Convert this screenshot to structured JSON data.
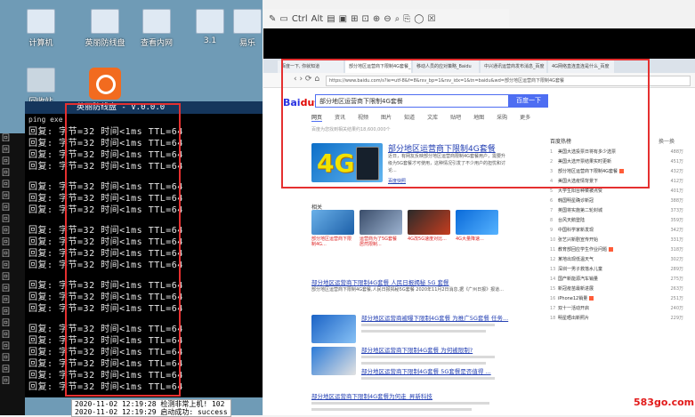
{
  "desktop": {
    "icons": [
      {
        "label": "计算机",
        "name": "computer"
      },
      {
        "label": "英丽防线盘",
        "name": "folder-1"
      },
      {
        "label": "查看内网",
        "name": "folder-2"
      },
      {
        "label": "3.1",
        "name": "folder-3"
      },
      {
        "label": "易乐",
        "name": "folder-4"
      },
      {
        "label": "回收站",
        "name": "recycle-bin"
      }
    ]
  },
  "console": {
    "title": "英丽防线盘 - V.0.0.0",
    "subtitle": "ping exe",
    "line_text": "回复: 字节=32 时间<1ms TTL=64",
    "status_lines": [
      "2020-11-02 12:19:28 检测非常上机! 102",
      "2020-11-02 12:19:29 启动成功: success"
    ]
  },
  "screenshot_toolbar": {
    "items": [
      "✎",
      "▭",
      "Ctrl",
      "Alt",
      "▤",
      "▣",
      "⊞",
      "⊡",
      "⊕",
      "⊖",
      "⌕",
      "⎘",
      "◯",
      "☒"
    ]
  },
  "browser": {
    "tabs": [
      "百度一下, 你就知道",
      "部分地区运营商下限制4G套餐_百度搜索",
      "移动人员的应对策略_Baidu",
      "中兴通讯运营商发布消息_百度",
      "4G网络直连直连是什么_百度"
    ],
    "url": "https://www.baidu.com/s?ie=utf-8&f=8&rsv_bp=1&rsv_idx=1&tn=baidu&wd=部分地区运营商下限制4G套餐",
    "logo": {
      "bai": "Bai",
      "du": "du",
      "suffix": "百度"
    },
    "search_query": "部分地区运营商下限制4G套餐",
    "search_button": "百度一下",
    "filters": [
      "网页",
      "资讯",
      "视频",
      "图片",
      "知道",
      "文库",
      "贴吧",
      "地图",
      "采购",
      "更多"
    ],
    "result_count": "百度为您找到相关结果约18,600,000个",
    "result1_title": "部分地区运营商下限制4G套餐",
    "result1_snippet": "近日，有网友反映部分地区运营商限制4G套餐用户，需要升级为5G套餐才可使用，这种情况引发了不少用户的担忧和讨论...",
    "result1_link": "百度快照",
    "related_label": "相关",
    "thumb_captions": [
      "部分地区运营商下限制4G...",
      "运营商为了5G套餐居然限制...",
      "4G改5G速度对比...",
      "4G大量降速..."
    ],
    "result2_title": "部分地区运营商下限制4G套餐 人民日报揭秘 5G 套餐",
    "result2_snippet": "部分地区运营商下限制4G套餐,人民日报揭秘5G套餐 2020年11月2日消息,据《广州日报》报道...",
    "result3_title": "部分地区运营商被曝下限制4G套餐 为推广5G套餐 任务...",
    "result4_title": "部分地区运营商下限制4G套餐 为何被限制?",
    "result5_title": "部分地区运营商下限制4G套餐 5G套餐是否值得 ...",
    "result6_title": "部分地区运营商下限制4G套餐为何走_昇新科技",
    "hot": {
      "title": "百度热榜",
      "more": "换一换",
      "rows": [
        {
          "n": "1",
          "t": "美国大选投票日将有多少选票",
          "v": "488万"
        },
        {
          "n": "2",
          "t": "美国大选开票结果实时更新",
          "v": "451万"
        },
        {
          "n": "3",
          "t": "部分地区运营商下限制4G套餐",
          "v": "432万"
        },
        {
          "n": "4",
          "t": "美国大选疫情背景下",
          "v": "412万"
        },
        {
          "n": "5",
          "t": "大学生阳台种菜被点赞",
          "v": "401万"
        },
        {
          "n": "6",
          "t": "韩国明星确诊新冠",
          "v": "388万"
        },
        {
          "n": "7",
          "t": "英国将实施第二轮封城",
          "v": "373万"
        },
        {
          "n": "8",
          "t": "台风天鹅登陆",
          "v": "359万"
        },
        {
          "n": "9",
          "t": "中国科学家新发现",
          "v": "342万"
        },
        {
          "n": "10",
          "t": "张艺兴新剧宣传开始",
          "v": "331万"
        },
        {
          "n": "11",
          "t": "教育部回应学生作业问题",
          "v": "318万"
        },
        {
          "n": "12",
          "t": "某地出现低温天气",
          "v": "302万"
        },
        {
          "n": "13",
          "t": "深圳一男子救落水儿童",
          "v": "289万"
        },
        {
          "n": "14",
          "t": "国产新能源汽车销量",
          "v": "275万"
        },
        {
          "n": "15",
          "t": "新冠疫苗最新进展",
          "v": "263万"
        },
        {
          "n": "16",
          "t": "iPhone12销量",
          "v": "251万"
        },
        {
          "n": "17",
          "t": "双十一活动开启",
          "v": "240万"
        },
        {
          "n": "18",
          "t": "明星晒出新照片",
          "v": "229万"
        }
      ]
    }
  },
  "watermark": "583go.com",
  "colors": {
    "accent": "#4e6ef2",
    "highlight_box": "#e53030",
    "link": "#2440b3"
  }
}
